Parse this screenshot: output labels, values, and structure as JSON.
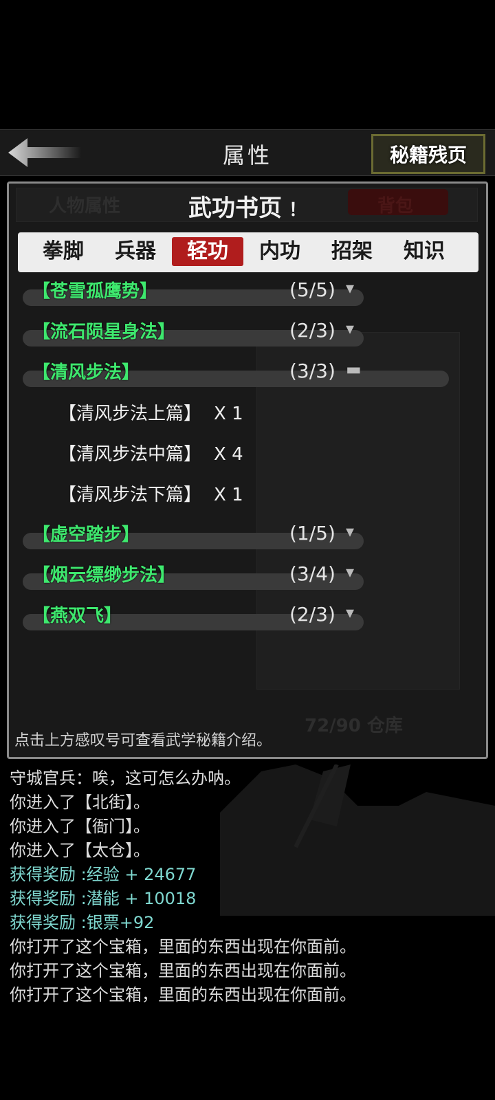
{
  "header": {
    "title": "属性",
    "fragments_label": "秘籍残页"
  },
  "panel": {
    "title": "武功书页",
    "info_mark": "！",
    "ghost": {
      "left_tab": "人物属性",
      "right_tab": "背包",
      "warehouse": "72/90 仓库"
    },
    "tabs": [
      {
        "label": "拳脚",
        "active": false
      },
      {
        "label": "兵器",
        "active": false
      },
      {
        "label": "轻功",
        "active": true
      },
      {
        "label": "内功",
        "active": false
      },
      {
        "label": "招架",
        "active": false
      },
      {
        "label": "知识",
        "active": false
      }
    ],
    "skills": [
      {
        "name": "【苍雪孤鹰势】",
        "count": "(5/5)",
        "toggle": "▾"
      },
      {
        "name": "【流石陨星身法】",
        "count": "(2/3)",
        "toggle": "▾"
      },
      {
        "name": "【清风步法】",
        "count": "(3/3)",
        "toggle": "▬"
      },
      {
        "name": "【虚空踏步】",
        "count": "(1/5)",
        "toggle": "▾"
      },
      {
        "name": "【烟云缥缈步法】",
        "count": "(3/4)",
        "toggle": "▾"
      },
      {
        "name": "【燕双飞】",
        "count": "(2/3)",
        "toggle": "▾"
      }
    ],
    "sub_pages": [
      {
        "name": "【清风步法上篇】",
        "qty": "X 1"
      },
      {
        "name": "【清风步法中篇】",
        "qty": "X 4"
      },
      {
        "name": "【清风步法下篇】",
        "qty": "X 1"
      }
    ],
    "hint": "点击上方感叹号可查看武学秘籍介绍。"
  },
  "log": [
    {
      "text": "守城官兵：唉，这可怎么办呐。",
      "teal": false
    },
    {
      "text": "你进入了【北街】。",
      "teal": false
    },
    {
      "text": "你进入了【衙门】。",
      "teal": false
    },
    {
      "text": "你进入了【太仓】。",
      "teal": false
    },
    {
      "text": "获得奖励 :经验 + 24677",
      "teal": true
    },
    {
      "text": "获得奖励 :潜能 + 10018",
      "teal": true
    },
    {
      "text": "获得奖励 :银票+92",
      "teal": true
    },
    {
      "text": "你打开了这个宝箱，里面的东西出现在你面前。",
      "teal": false
    },
    {
      "text": "你打开了这个宝箱，里面的东西出现在你面前。",
      "teal": false
    },
    {
      "text": "你打开了这个宝箱，里面的东西出现在你面前。",
      "teal": false
    }
  ],
  "colors": {
    "skill_green": "#3ee86e",
    "active_tab": "#b01d1d",
    "panel_border": "#8a8a8a",
    "reward_teal": "#7fd8d0"
  }
}
